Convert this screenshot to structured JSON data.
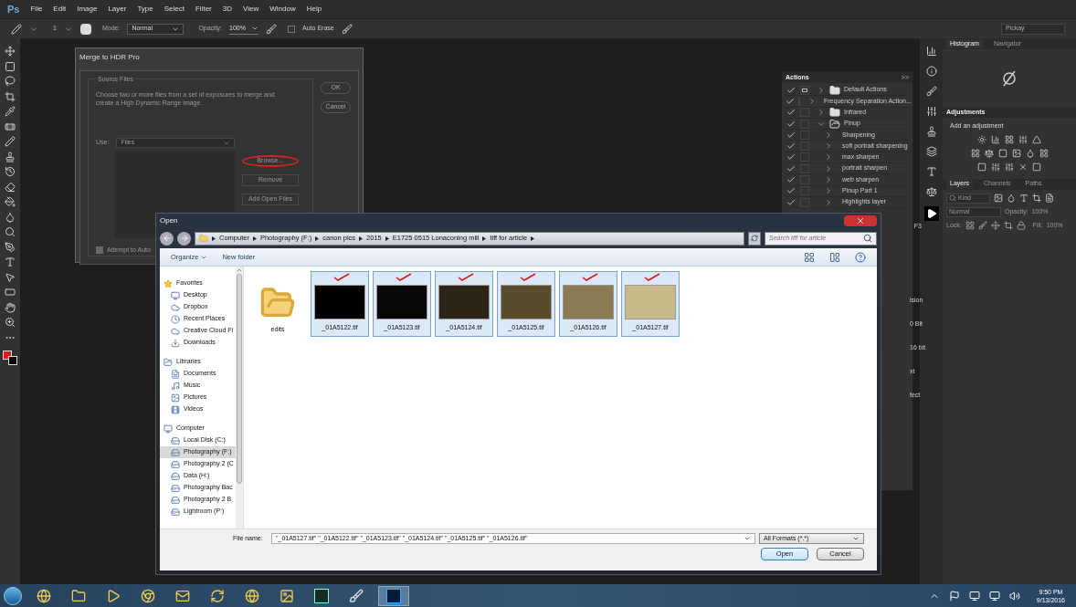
{
  "app": {
    "logo": "Ps",
    "menu": [
      "File",
      "Edit",
      "Image",
      "Layer",
      "Type",
      "Select",
      "Filter",
      "3D",
      "View",
      "Window",
      "Help"
    ],
    "workspace": "Pickay"
  },
  "options_bar": {
    "brush_size": "1",
    "mode_label": "Mode:",
    "mode": "Normal",
    "opacity_label": "Opacity:",
    "opacity": "100%",
    "auto_erase": {
      "label": "Auto Erase",
      "checked": false
    }
  },
  "actions_panel": {
    "title": "Actions",
    "collapse": ">>",
    "rows": [
      {
        "label": "Default Actions",
        "kind": "set",
        "checked": true,
        "dialog": true,
        "expanded": false
      },
      {
        "label": "Frequency Separation Action...",
        "kind": "set",
        "checked": true,
        "dialog": false,
        "expanded": false
      },
      {
        "label": "Infrared",
        "kind": "set",
        "checked": true,
        "dialog": false,
        "expanded": false
      },
      {
        "label": "Pinup",
        "kind": "set",
        "checked": true,
        "dialog": false,
        "expanded": true,
        "children": [
          {
            "label": "Sharpening",
            "kind": "action",
            "checked": true,
            "dialog": false,
            "expanded": false
          },
          {
            "label": "soft portrait sharpening",
            "kind": "action",
            "checked": true,
            "dialog": false,
            "expanded": false
          },
          {
            "label": "max sharpen",
            "kind": "action",
            "checked": true,
            "dialog": false,
            "expanded": false
          },
          {
            "label": "portrait sharpen",
            "kind": "action",
            "checked": true,
            "dialog": false,
            "expanded": false
          },
          {
            "label": "web sharpen",
            "kind": "action",
            "checked": true,
            "dialog": false,
            "expanded": false
          },
          {
            "label": "Pinup Part 1",
            "kind": "action",
            "checked": true,
            "dialog": false,
            "expanded": false
          },
          {
            "label": "Highlights layer",
            "kind": "action",
            "checked": true,
            "dialog": false,
            "expanded": false
          }
        ]
      }
    ],
    "shortcut": "F3",
    "fragments": [
      "ision",
      "0 Bit",
      "16 bit",
      "xt",
      "fect"
    ]
  },
  "histogram_panel": {
    "tabs": [
      {
        "label": "Histogram",
        "selected": true
      },
      {
        "label": "Navigator",
        "selected": false
      }
    ]
  },
  "adjustments_panel": {
    "title": "Adjustments",
    "hint": "Add an adjustment"
  },
  "layers_panel": {
    "tabs": [
      {
        "label": "Layers",
        "selected": true
      },
      {
        "label": "Channels",
        "selected": false
      },
      {
        "label": "Paths",
        "selected": false
      }
    ],
    "filter_placeholder": "Kind",
    "blend_mode": "Normal",
    "opacity_label": "Opacity:",
    "opacity": "100%",
    "lock_label": "Lock:",
    "fill_label": "Fill:",
    "fill": "100%"
  },
  "merge_dialog": {
    "title": "Merge to HDR Pro",
    "group": "Source Files",
    "description": "Choose two or more files from a set of exposures to merge and create a High Dynamic Range image.",
    "use_label": "Use:",
    "use_value": "Files",
    "buttons": [
      {
        "label": "Browse...",
        "circled": true
      },
      {
        "label": "Remove",
        "circled": false
      },
      {
        "label": "Add Open Files",
        "circled": false
      }
    ],
    "ok": "OK",
    "cancel": "Cancel",
    "auto_align": {
      "label": "Attempt to Auto",
      "checked": true
    }
  },
  "open_dialog": {
    "title": "Open",
    "path": [
      "Computer",
      "Photography (F:)",
      "canon pics",
      "2015",
      "E1725 0515 Lonaconing mill",
      "tiff for article"
    ],
    "search_placeholder": "Search tiff for article",
    "organize": "Organize",
    "new_folder": "New folder",
    "nav": [
      {
        "label": "Favorites",
        "kind": "favorites",
        "selected": false,
        "children": [
          {
            "label": "Desktop",
            "kind": "desktop",
            "selected": false
          },
          {
            "label": "Dropbox",
            "kind": "dropbox",
            "selected": false
          },
          {
            "label": "Recent Places",
            "kind": "recent",
            "selected": false
          },
          {
            "label": "Creative Cloud Fi",
            "kind": "cloud",
            "selected": false
          },
          {
            "label": "Downloads",
            "kind": "downloads",
            "selected": false
          }
        ]
      },
      {
        "label": "Libraries",
        "kind": "library",
        "selected": false,
        "children": [
          {
            "label": "Documents",
            "kind": "documents",
            "selected": false
          },
          {
            "label": "Music",
            "kind": "music",
            "selected": false
          },
          {
            "label": "Pictures",
            "kind": "pictures",
            "selected": false
          },
          {
            "label": "Videos",
            "kind": "videos",
            "selected": false
          }
        ]
      },
      {
        "label": "Computer",
        "kind": "computer",
        "selected": false,
        "children": [
          {
            "label": "Local Disk (C:)",
            "kind": "disk",
            "selected": false
          },
          {
            "label": "Photography (F:)",
            "kind": "drive",
            "selected": true
          },
          {
            "label": "Photography 2 (C",
            "kind": "drive",
            "selected": false
          },
          {
            "label": "Data (H:)",
            "kind": "drive",
            "selected": false
          },
          {
            "label": "Photography Bac",
            "kind": "drive",
            "selected": false
          },
          {
            "label": "Photography 2 B",
            "kind": "drive",
            "selected": false
          },
          {
            "label": "Lightroom (P:)",
            "kind": "removable",
            "selected": false
          }
        ]
      }
    ],
    "files": [
      {
        "name": "edits",
        "kind": "folder",
        "selected": false,
        "marked": false
      },
      {
        "name": "_01A5122.tif",
        "kind": "image",
        "selected": true,
        "marked": true
      },
      {
        "name": "_01A5123.tif",
        "kind": "image",
        "selected": true,
        "marked": true
      },
      {
        "name": "_01A5124.tif",
        "kind": "image",
        "selected": true,
        "marked": true
      },
      {
        "name": "_01A5125.tif",
        "kind": "image",
        "selected": true,
        "marked": true
      },
      {
        "name": "_01A5126.tif",
        "kind": "image",
        "selected": true,
        "marked": true
      },
      {
        "name": "_01A5127.tif",
        "kind": "image",
        "selected": true,
        "marked": true
      }
    ],
    "file_name_label": "File name:",
    "file_name": "\"_01A5127.tif\" \"_01A5122.tif\" \"_01A5123.tif\" \"_01A5124.tif\" \"_01A5125.tif\" \"_01A5126.tif\"",
    "file_type": "All Formats (*.*)",
    "open": "Open",
    "cancel": "Cancel"
  },
  "taskbar": {
    "time": "9:50 PM",
    "date": "9/13/2016"
  }
}
